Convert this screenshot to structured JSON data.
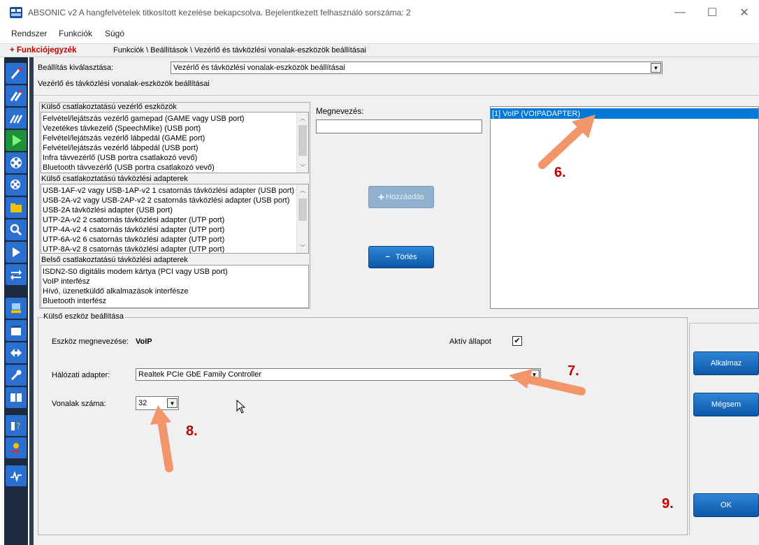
{
  "window": {
    "title": "ABSONIC v2 A hangfelvételek titkosított kezelése bekapcsolva. Bejelentkezett felhasználó sorszáma: 2",
    "minimize": "—",
    "maximize": "☐",
    "close": "✕"
  },
  "menu": [
    "Rendszer",
    "Funkciók",
    "Súgó"
  ],
  "breadcrumb": {
    "funcbar": "+ Funkciójegyzék",
    "path": "Funkciók \\ Beállítások \\ Vezérlő és távközlési vonalak-eszközök beállításai"
  },
  "settings": {
    "select_label": "Beállítás kiválasztása:",
    "select_value": "Vezérlő és távközlési vonalak-eszközök beállításai",
    "subtitle": "Vezérlő és távközlési vonalak-eszközök beállításai"
  },
  "external_controllers": {
    "label": "Külső csatlakoztatású vezérlő eszközök",
    "items": [
      "Felvétel/lejátszás vezérlő gamepad (GAME vagy USB port)",
      "Vezetékes távkezelő (SpeechMike) (USB port)",
      "Felvétel/lejátszás vezérlő lábpedál (GAME port)",
      "Felvétel/lejátszás vezérlő lábpedál (USB port)",
      "Infra távvezérlő (USB portra csatlakozó vevő)",
      "Bluetooth távvezérlő (USB portra csatlakozó vevő)"
    ]
  },
  "external_adapters": {
    "label": "Külső csatlakoztatású távközlési adapterek",
    "items": [
      "USB-1AF-v2 vagy USB-1AP-v2 1 csatornás távközlési adapter (USB port)",
      "USB-2A-v2 vagy USB-2AP-v2 2 csatornás távközlési adapter (USB port)",
      "USB-2A távközlési adapter (USB port)",
      "UTP-2A-v2 2 csatornás távközlési adapter (UTP port)",
      "UTP-4A-v2 4 csatornás távközlési adapter (UTP port)",
      "UTP-6A-v2 6 csatornás távközlési adapter (UTP port)",
      "UTP-8A-v2 8 csatornás távközlési adapter (UTP port)"
    ]
  },
  "internal_adapters": {
    "label": "Belső csatlakoztatású távközlési adapterek",
    "items": [
      "ISDN2-S0 digitális modem kártya (PCI vagy USB port)",
      "VoIP interfész",
      "Hívó, üzenetküldő alkalmazások interfésze",
      "Bluetooth interfész"
    ]
  },
  "name_field": {
    "label": "Megnevezés:",
    "value": ""
  },
  "buttons": {
    "add": "Hozzáadás",
    "delete": "Törlés",
    "apply": "Alkalmaz",
    "cancel": "Mégsem",
    "ok": "OK"
  },
  "device_list": [
    "[1] VoIP (VOIPADAPTER)"
  ],
  "device_settings": {
    "label": "Külső eszköz beállítása",
    "name_label": "Eszköz megnevezése:",
    "name_value": "VoIP",
    "active_label": "Aktív állapot",
    "active_checked": true,
    "adapter_label": "Hálózati adapter:",
    "adapter_value": "Realtek PCIe GbE Family Controller",
    "lines_label": "Vonalak száma:",
    "lines_value": "32"
  },
  "annotations": [
    "6.",
    "7.",
    "8.",
    "9."
  ],
  "colors": {
    "accent": "#0078d7",
    "button_blue": "#1466bd",
    "annotation_red": "#c00000",
    "arrow_orange": "#f3956a",
    "sidebar": "#1c2a40"
  }
}
